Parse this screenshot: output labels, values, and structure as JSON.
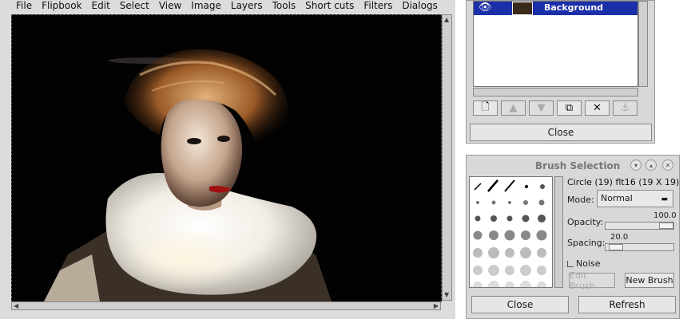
{
  "menubar": {
    "items": [
      "File",
      "Flipbook",
      "Edit",
      "Select",
      "View",
      "Image",
      "Layers",
      "Tools",
      "Short cuts",
      "Filters",
      "Dialogs"
    ]
  },
  "canvas": {
    "background": "#000000",
    "subject": "portrait-photo"
  },
  "layers": {
    "layer_name": "Background",
    "selected_color": "#1a2fa8",
    "icons": [
      "new-layer-icon",
      "raise-layer-icon",
      "lower-layer-icon",
      "duplicate-layer-icon",
      "delete-layer-icon",
      "anchor-layer-icon"
    ],
    "close_label": "Close"
  },
  "brush": {
    "title": "Brush Selection",
    "selected_info": "Circle (19) flt16  (19 X 19)",
    "mode_label": "Mode:",
    "mode_value": "Normal",
    "opacity_label": "Opacity:",
    "opacity_value": "100.0",
    "opacity_fraction": 1.0,
    "spacing_label": "Spacing:",
    "spacing_value": "20.0",
    "spacing_fraction": 0.2,
    "noise_label": "Noise",
    "edit_label": "Edit Brush",
    "new_label": "New Brush",
    "close_label": "Close",
    "refresh_label": "Refresh"
  }
}
